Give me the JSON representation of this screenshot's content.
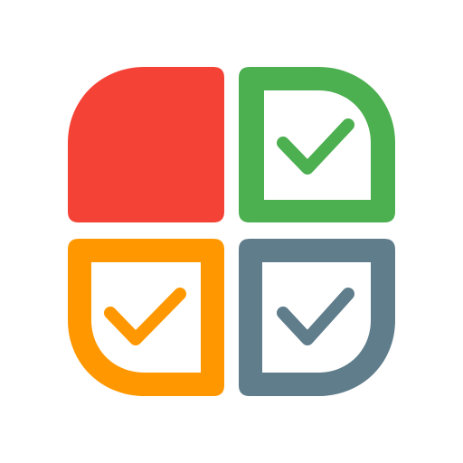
{
  "icon": {
    "name": "checklist-grid-app-icon",
    "background": "#FFFFFF",
    "tiles": [
      {
        "id": "top-left",
        "color": "#F44336",
        "filled": true,
        "checked": false
      },
      {
        "id": "top-right",
        "color": "#4CAF50",
        "filled": false,
        "checked": true,
        "check_color": "#4CAF50"
      },
      {
        "id": "bottom-left",
        "color": "#FF9800",
        "filled": false,
        "checked": true,
        "check_color": "#FF9800"
      },
      {
        "id": "bottom-right",
        "color": "#607D8B",
        "filled": false,
        "checked": true,
        "check_color": "#607D8B"
      }
    ]
  }
}
